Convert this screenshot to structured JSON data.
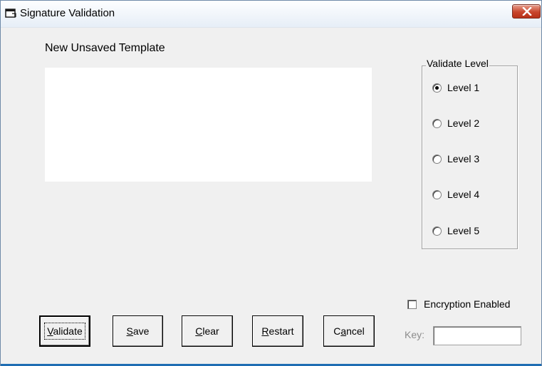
{
  "window": {
    "title": "Signature Validation",
    "icon": "form-window-icon",
    "close_icon": "close-x-icon",
    "accent_close": "#c8452b",
    "accent_bottom": "#1f6db3"
  },
  "template": {
    "name": "New Unsaved Template"
  },
  "validate_level": {
    "title": "Validate Level",
    "options": [
      {
        "label": "Level 1",
        "checked": true
      },
      {
        "label": "Level 2",
        "checked": false
      },
      {
        "label": "Level 3",
        "checked": false
      },
      {
        "label": "Level 4",
        "checked": false
      },
      {
        "label": "Level 5",
        "checked": false
      }
    ]
  },
  "encryption": {
    "label": "Encryption Enabled",
    "checked": false,
    "key_label": "Key:",
    "key_value": ""
  },
  "buttons": {
    "validate": {
      "pre": "",
      "accel": "V",
      "post": "alidate"
    },
    "save": {
      "pre": "",
      "accel": "S",
      "post": "ave"
    },
    "clear": {
      "pre": "",
      "accel": "C",
      "post": "lear"
    },
    "restart": {
      "pre": "",
      "accel": "R",
      "post": "estart"
    },
    "cancel": {
      "pre": "C",
      "accel": "a",
      "post": "ncel"
    }
  }
}
